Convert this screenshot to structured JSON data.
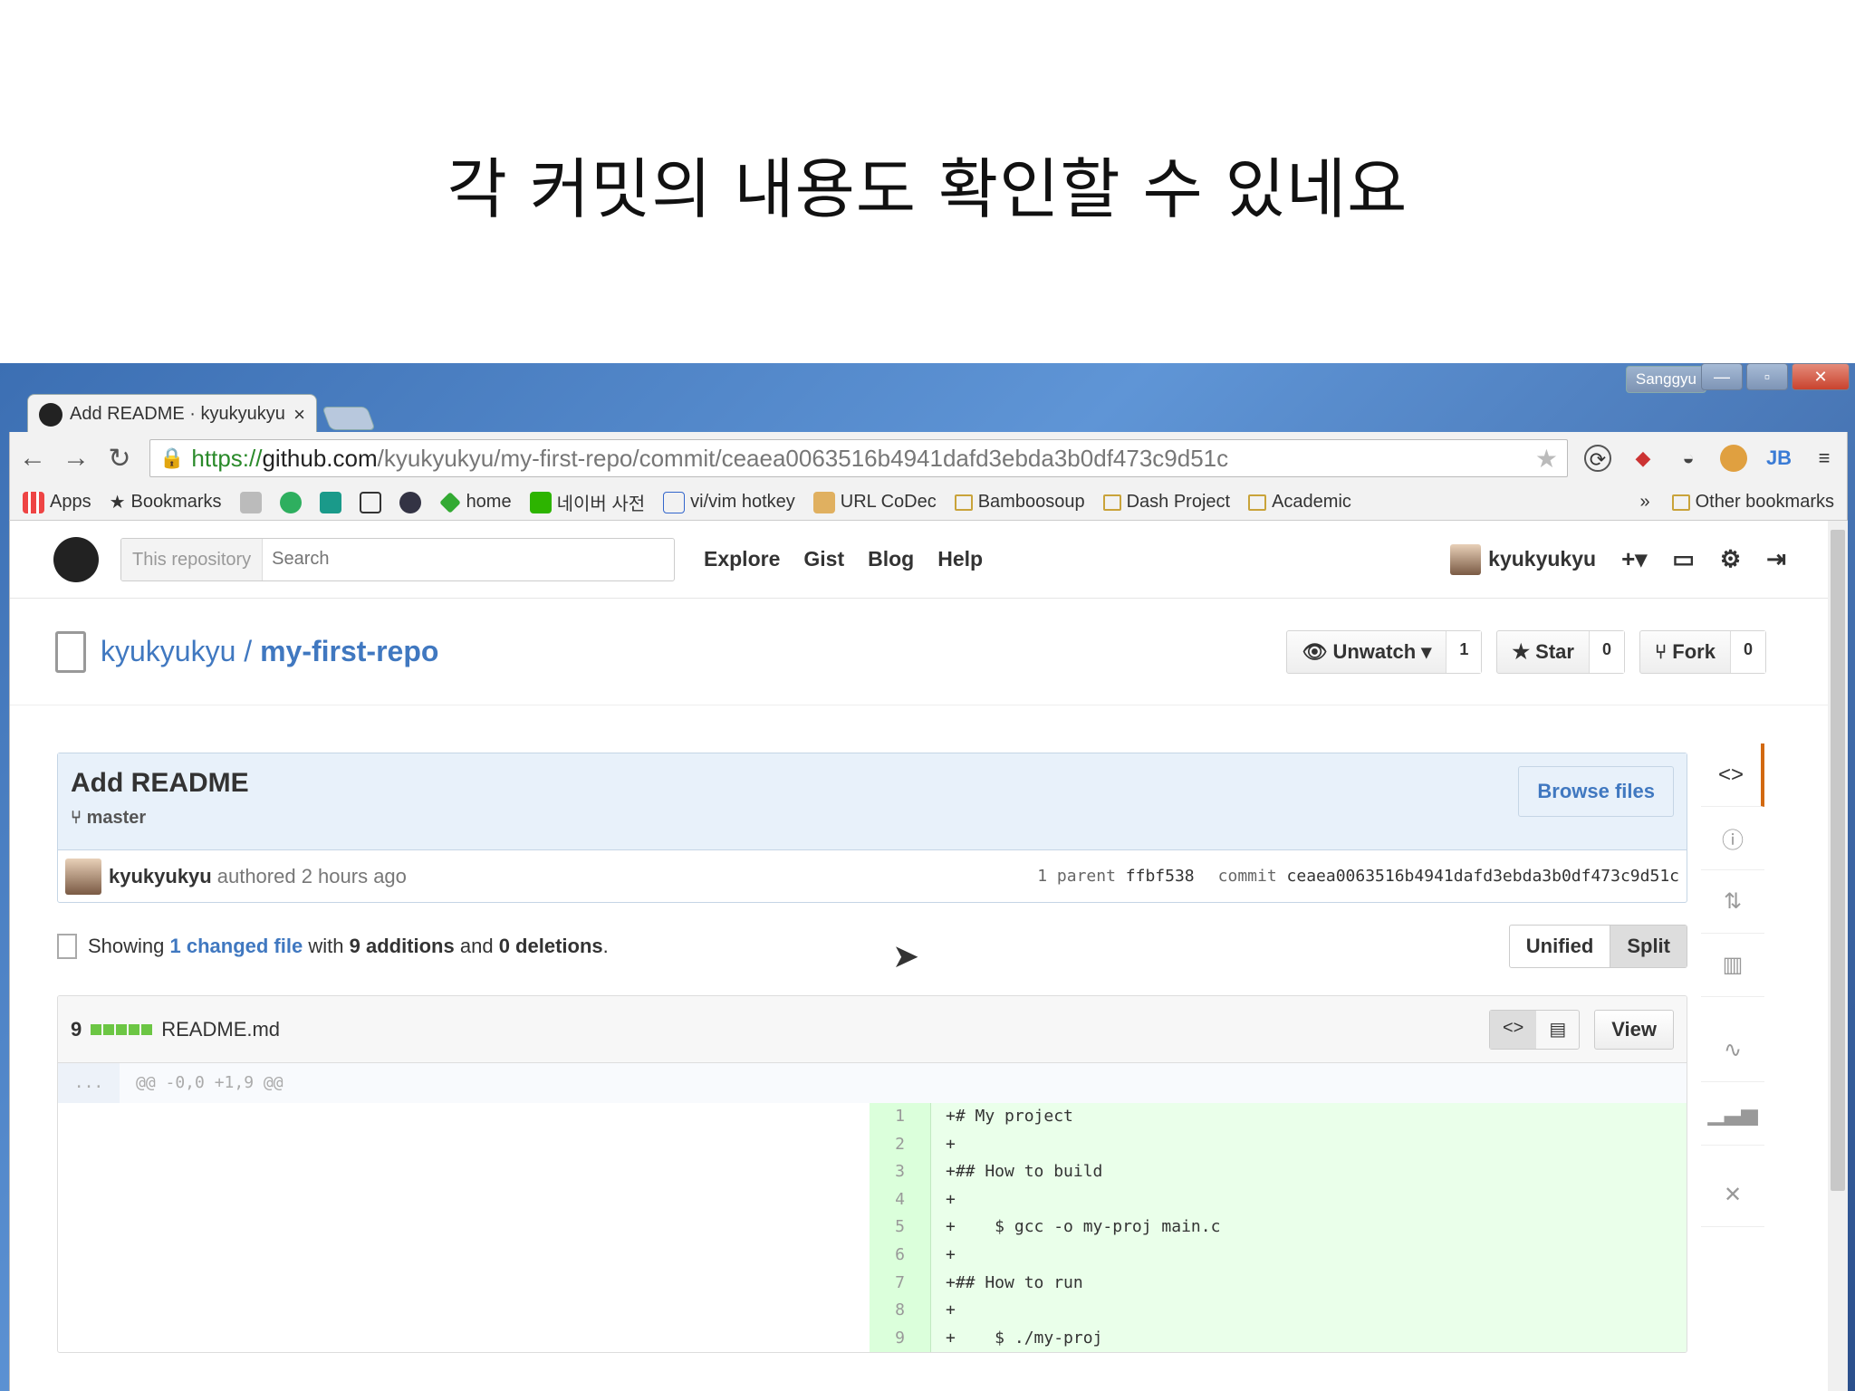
{
  "slide": {
    "title": "각 커밋의 내용도 확인할 수 있네요"
  },
  "window": {
    "user_badge": "Sanggyu",
    "minimize": "—",
    "maximize": "▫",
    "close": "✕"
  },
  "tab": {
    "title": "Add README · kyukyukyu",
    "close": "×"
  },
  "omnibox": {
    "scheme": "https://",
    "host": "github.com",
    "path": "/kyukyukyu/my-first-repo/commit/ceaea0063516b4941dafd3ebda3b0df473c9d51c"
  },
  "bookmarks": {
    "items": [
      "Apps",
      "Bookmarks",
      "home",
      "네이버 사전",
      "vi/vim hotkey",
      "URL CoDec",
      "Bamboosoup",
      "Dash Project",
      "Academic"
    ],
    "overflow": "»",
    "other": "Other bookmarks"
  },
  "gh_header": {
    "search_scope": "This repository",
    "search_placeholder": "Search",
    "nav": [
      "Explore",
      "Gist",
      "Blog",
      "Help"
    ],
    "username": "kyukyukyu"
  },
  "repo": {
    "owner": "kyukyukyu",
    "separator": " / ",
    "name": "my-first-repo",
    "watch_label": "Unwatch ▾",
    "watch_count": "1",
    "star_label": "Star",
    "star_count": "0",
    "fork_label": "Fork",
    "fork_count": "0"
  },
  "commit": {
    "title": "Add README",
    "branch": "master",
    "browse_label": "Browse files",
    "author": "kyukyukyu",
    "authored": "authored 2 hours ago",
    "parent_label": "1 parent",
    "parent_sha": "ffbf538",
    "commit_label": "commit",
    "sha": "ceaea0063516b4941dafd3ebda3b0df473c9d51c"
  },
  "toc": {
    "showing": "Showing",
    "changed": "1 changed file",
    "with": "with",
    "additions": "9 additions",
    "and": "and",
    "deletions": "0 deletions",
    "period": ".",
    "unified": "Unified",
    "split": "Split"
  },
  "file": {
    "count": "9",
    "name": "README.md",
    "view_label": "View",
    "hunk_dots": "...",
    "hunk_header": "@@ -0,0 +1,9 @@",
    "lines": [
      {
        "n": "1",
        "code": "+# My project"
      },
      {
        "n": "2",
        "code": "+"
      },
      {
        "n": "3",
        "code": "+## How to build"
      },
      {
        "n": "4",
        "code": "+"
      },
      {
        "n": "5",
        "code": "+    $ gcc -o my-proj main.c"
      },
      {
        "n": "6",
        "code": "+"
      },
      {
        "n": "7",
        "code": "+## How to run"
      },
      {
        "n": "8",
        "code": "+"
      },
      {
        "n": "9",
        "code": "+    $ ./my-proj"
      }
    ]
  }
}
